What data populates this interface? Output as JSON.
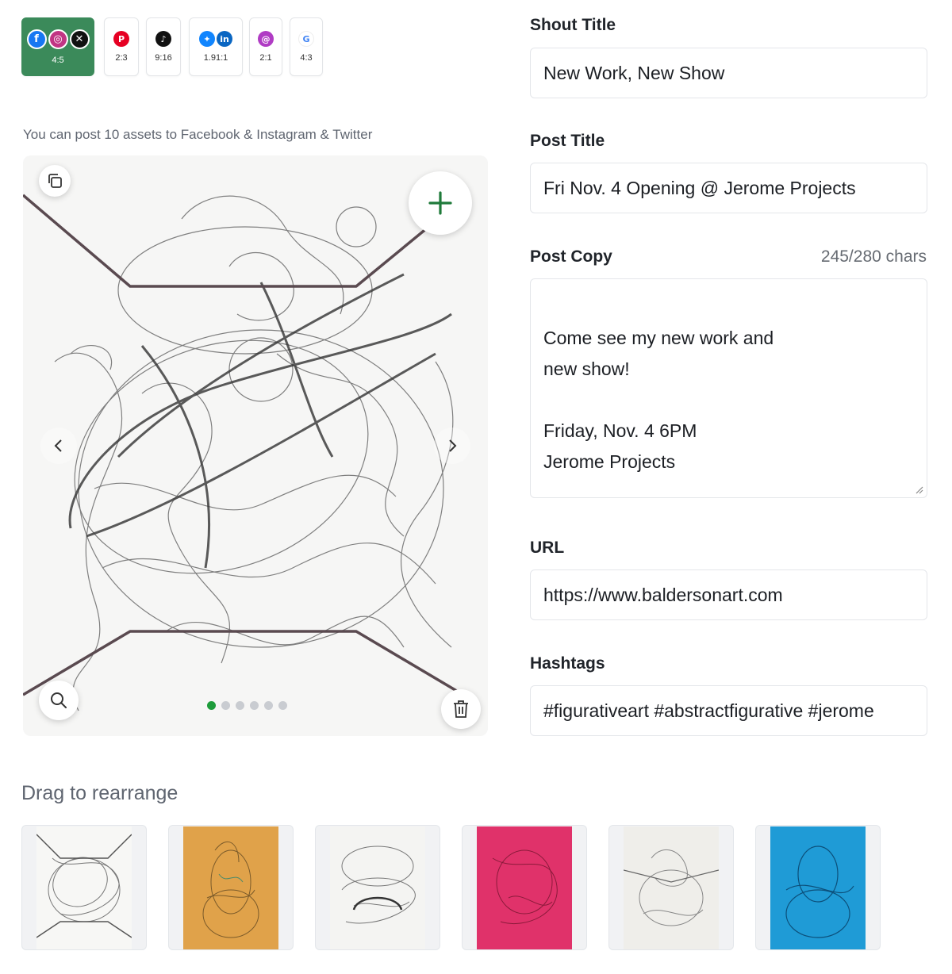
{
  "ratios": [
    {
      "label": "4:5",
      "icons": [
        "facebook-icon",
        "instagram-icon",
        "x-icon"
      ],
      "active": true
    },
    {
      "label": "2:3",
      "icons": [
        "pinterest-icon"
      ]
    },
    {
      "label": "9:16",
      "icons": [
        "tiktok-icon"
      ]
    },
    {
      "label": "1.91:1",
      "icons": [
        "bluesky-icon",
        "linkedin-icon"
      ]
    },
    {
      "label": "2:1",
      "icons": [
        "threads-icon"
      ]
    },
    {
      "label": "4:3",
      "icons": [
        "google-icon"
      ]
    }
  ],
  "helper_text": "You can post 10 assets to Facebook & Instagram & Twitter",
  "carousel": {
    "slide_count": 6,
    "active_slide": 0
  },
  "form": {
    "shout_title": {
      "label": "Shout Title",
      "value": "New Work, New Show"
    },
    "post_title": {
      "label": "Post Title",
      "value": "Fri Nov. 4 Opening @ Jerome Projects"
    },
    "post_copy": {
      "label": "Post Copy",
      "count": "245/280 chars",
      "value": "Come see my new work and\nnew show!\n\nFriday, Nov. 4 6PM\nJerome Projects"
    },
    "url": {
      "label": "URL",
      "value": "https://www.baldersonart.com"
    },
    "hashtags": {
      "label": "Hashtags",
      "value": "#figurativeart #abstractfigurative #jerome"
    }
  },
  "drag_label": "Drag to rearrange",
  "thumbnails": [
    {
      "name": "thumb-1",
      "color": "#f5f5f3"
    },
    {
      "name": "thumb-2",
      "color": "#e0a24a"
    },
    {
      "name": "thumb-3",
      "color": "#f3f3f1"
    },
    {
      "name": "thumb-4",
      "color": "#e0326a"
    },
    {
      "name": "thumb-5",
      "color": "#efeeea"
    },
    {
      "name": "thumb-6",
      "color": "#1f9bd6"
    }
  ],
  "colors": {
    "accent": "#3b8a5a",
    "active_dot": "#1e9c3b",
    "plus": "#1f7a3a"
  }
}
